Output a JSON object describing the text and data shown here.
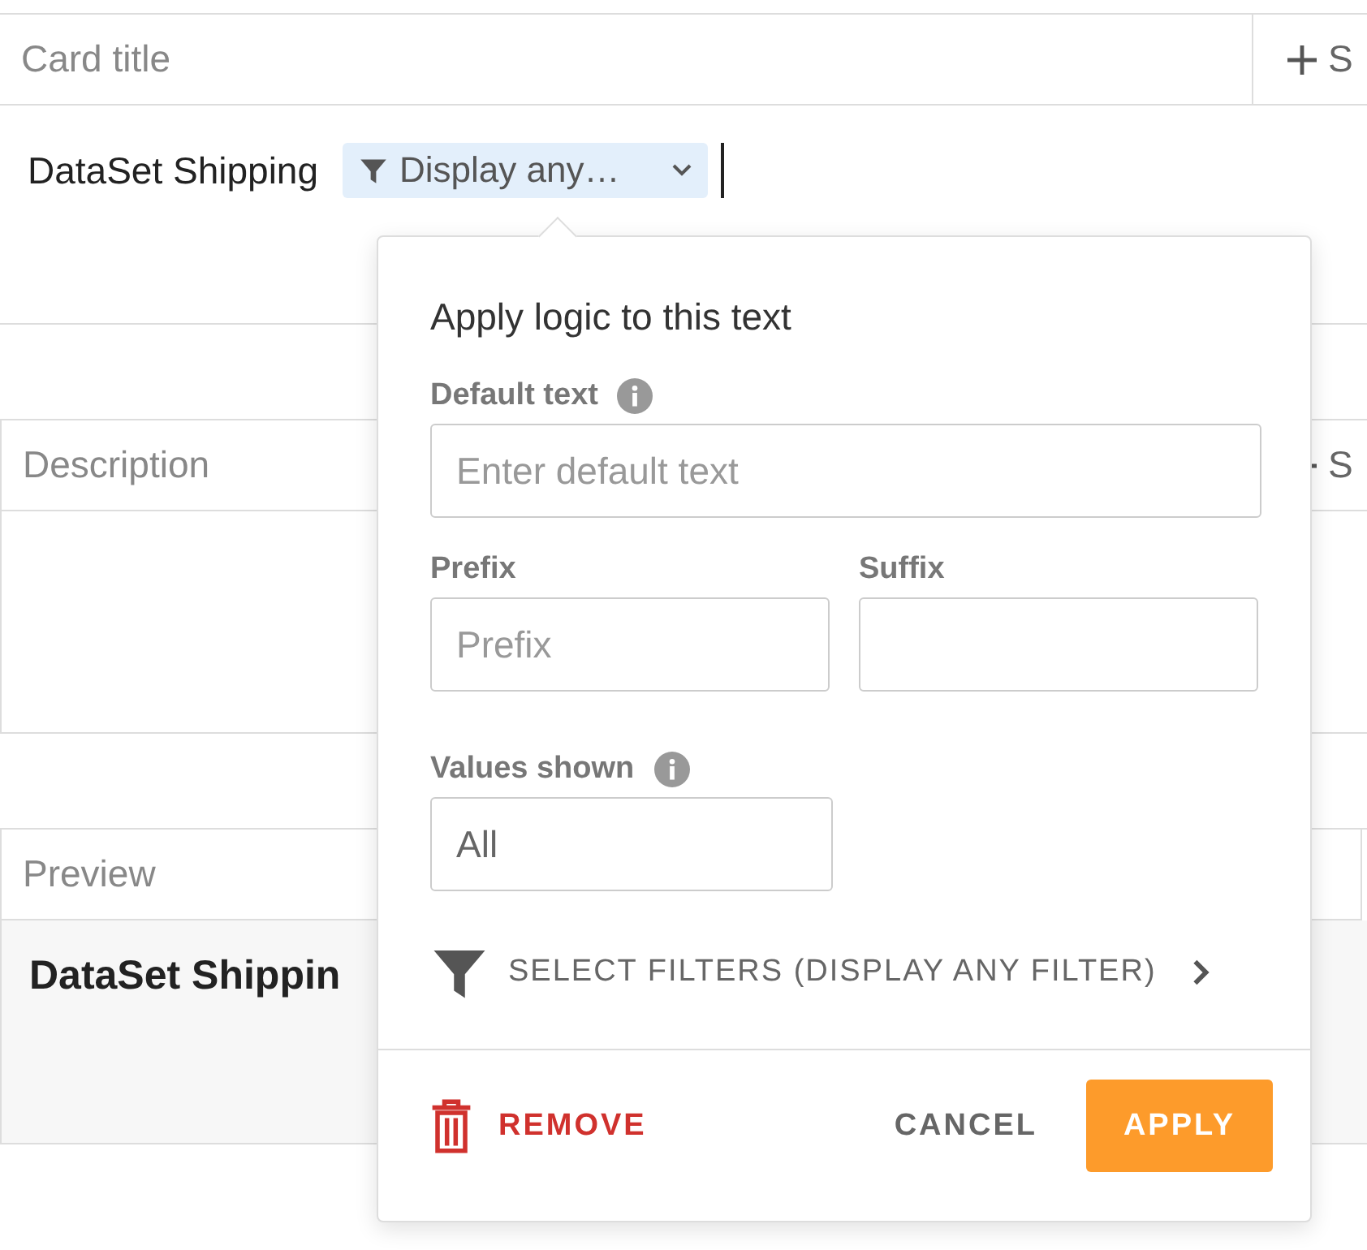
{
  "card_title": {
    "label": "Card title",
    "add_button": "S"
  },
  "title_editor": {
    "text": "DataSet Shipping",
    "token": "Display any…"
  },
  "description": {
    "label": "Description",
    "add_button": "S"
  },
  "preview": {
    "label": "Preview",
    "text": "DataSet Shippin"
  },
  "popover": {
    "title": "Apply logic to this text",
    "default_text": {
      "label": "Default text",
      "info": true,
      "placeholder": "Enter default text"
    },
    "prefix": {
      "label": "Prefix",
      "info": false,
      "placeholder": "Prefix"
    },
    "suffix": {
      "label": "Suffix",
      "info": false
    },
    "values_shown": {
      "label": "Values shown",
      "info": true,
      "value": "All"
    },
    "filters_link": "SELECT FILTERS (DISPLAY ANY FILTER)",
    "buttons": {
      "remove": "REMOVE",
      "cancel": "CANCEL",
      "apply": "APPLY"
    }
  }
}
